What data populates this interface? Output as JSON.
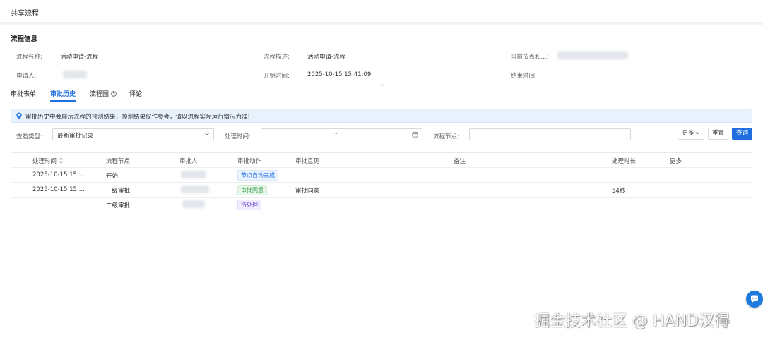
{
  "window": {
    "title": "共享流程"
  },
  "info": {
    "section_title": "流程信息",
    "name_label": "流程名称:",
    "name_value": "活动申请-流程",
    "desc_label": "流程描述:",
    "desc_value": "活动申请-流程",
    "current_label": "当前节点和...:",
    "applicant_label": "申请人:",
    "start_label": "开始时间:",
    "start_value": "2025-10-15 15:41:09",
    "end_label": "结束时间:"
  },
  "tabs": [
    {
      "label": "审批表单"
    },
    {
      "label": "审批历史",
      "active": true
    },
    {
      "label": "流程图"
    },
    {
      "label": "评论"
    }
  ],
  "notice": {
    "text": "审批历史中会展示流程的预测结果，预测结果仅作参考，请以流程实际运行情况为准!"
  },
  "filters": {
    "view_type_label": "查看类型:",
    "view_type_value": "最新审批记录",
    "time_label": "处理时间:",
    "time_sep": "-",
    "node_label": "流程节点:",
    "more_label": "更多",
    "reset_label": "重置",
    "query_label": "查询"
  },
  "table": {
    "headers": [
      "处理时间",
      "流程节点",
      "审批人",
      "审批动作",
      "审批意见",
      "备注",
      "处理时长",
      "更多"
    ],
    "rows": [
      {
        "time": "2025-10-15 15:...",
        "node": "开始",
        "action": "节点自动完成",
        "action_color": "blue",
        "opinion": "",
        "duration": ""
      },
      {
        "time": "2025-10-15 15:...",
        "node": "一级审批",
        "action": "审批同意",
        "action_color": "green",
        "opinion": "审批同意",
        "duration": "54秒"
      },
      {
        "time": "",
        "node": "二级审批",
        "action": "待处理",
        "action_color": "purple",
        "opinion": "",
        "duration": ""
      }
    ]
  },
  "watermark": "掘金技术社区 @ HAND汉得",
  "colors": {
    "primary": "#1f6fe0",
    "notice_bg": "#e8f2fd",
    "tag_blue": "#2e7be8",
    "tag_green": "#2b9b43",
    "tag_purple": "#6a4bd8"
  },
  "icons": [
    "location-pin-icon",
    "chevron-down-icon",
    "calendar-icon",
    "sort-icon",
    "help-circle-icon",
    "chat-icon"
  ]
}
